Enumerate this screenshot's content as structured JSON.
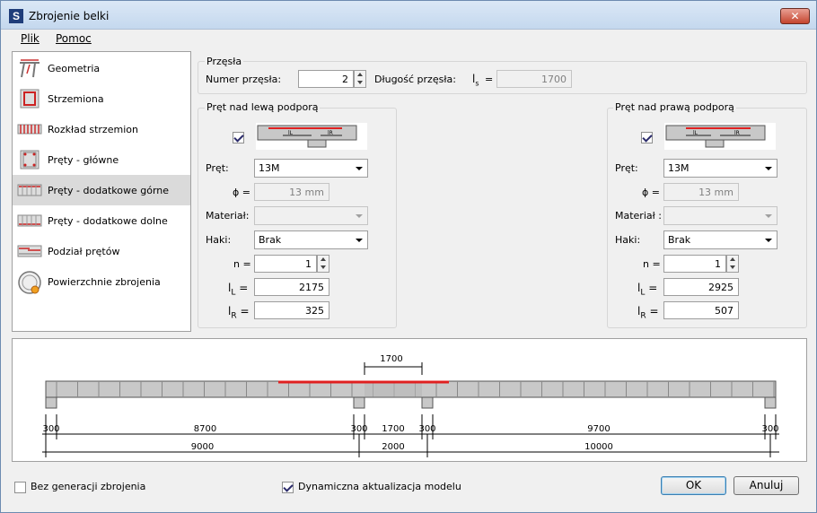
{
  "window": {
    "title": "Zbrojenie belki",
    "close": "✕"
  },
  "menu": {
    "file": "Plik",
    "help": "Pomoc"
  },
  "nav": [
    {
      "label": "Geometria",
      "icon": "geometry-icon"
    },
    {
      "label": "Strzemiona",
      "icon": "stirrups-icon"
    },
    {
      "label": "Rozkład strzemion",
      "icon": "stirrup-distribution-icon"
    },
    {
      "label": "Pręty - główne",
      "icon": "main-bars-icon"
    },
    {
      "label": "Pręty - dodatkowe górne",
      "icon": "additional-top-bars-icon",
      "selected": true
    },
    {
      "label": "Pręty - dodatkowe dolne",
      "icon": "additional-bottom-bars-icon"
    },
    {
      "label": "Podział prętów",
      "icon": "bar-division-icon"
    },
    {
      "label": "Powierzchnie zbrojenia",
      "icon": "reinforcement-areas-icon"
    }
  ],
  "span": {
    "group": "Przęsła",
    "number_label": "Numer przęsła:",
    "number_value": "2",
    "length_label": "Długość przęsła:",
    "ls_label": "l",
    "ls_sub": "s",
    "ls_eq": "=",
    "length_value": "1700"
  },
  "left_support": {
    "group": "Pręt nad lewą podporą",
    "checked": true,
    "bar_label": "Pręt:",
    "bar_value": "13M",
    "phi_label": "ϕ =",
    "phi_value": "13 mm",
    "material_label": "Materiał:",
    "material_value": "",
    "hooks_label": "Haki:",
    "hooks_value": "Brak",
    "n_label": "n =",
    "n_value": "1",
    "lL_label": "l",
    "lL_sub": "L",
    "lL_eq": "=",
    "lL_value": "2175",
    "lR_label": "l",
    "lR_sub": "R",
    "lR_eq": "=",
    "lR_value": "325"
  },
  "right_support": {
    "group": "Pręt nad prawą podporą",
    "checked": true,
    "bar_label": "Pręt:",
    "bar_value": "13M",
    "phi_label": "ϕ =",
    "phi_value": "13 mm",
    "material_label": "Materiał :",
    "material_value": "",
    "hooks_label": "Haki:",
    "hooks_value": "Brak",
    "n_label": "n =",
    "n_value": "1",
    "lL_label": "l",
    "lL_sub": "L",
    "lL_eq": "=",
    "lL_value": "2925",
    "lR_label": "l",
    "lR_sub": "R",
    "lR_eq": "=",
    "lR_value": "507"
  },
  "thumb": {
    "lL": "lL",
    "lR": "lR"
  },
  "diagram": {
    "top_dim": "1700",
    "row1": [
      "300",
      "8700",
      "300",
      "1700",
      "300",
      "9700",
      "300"
    ],
    "row2": [
      "9000",
      "2000",
      "10000"
    ]
  },
  "footer": {
    "no_generation": "Bez generacji zbrojenia",
    "no_generation_checked": false,
    "dynamic_update": "Dynamiczna aktualizacja modelu",
    "dynamic_update_checked": true,
    "ok": "OK",
    "cancel": "Anuluj"
  },
  "colors": {
    "bar": "#e02020",
    "beam": "#c8c8c8"
  }
}
